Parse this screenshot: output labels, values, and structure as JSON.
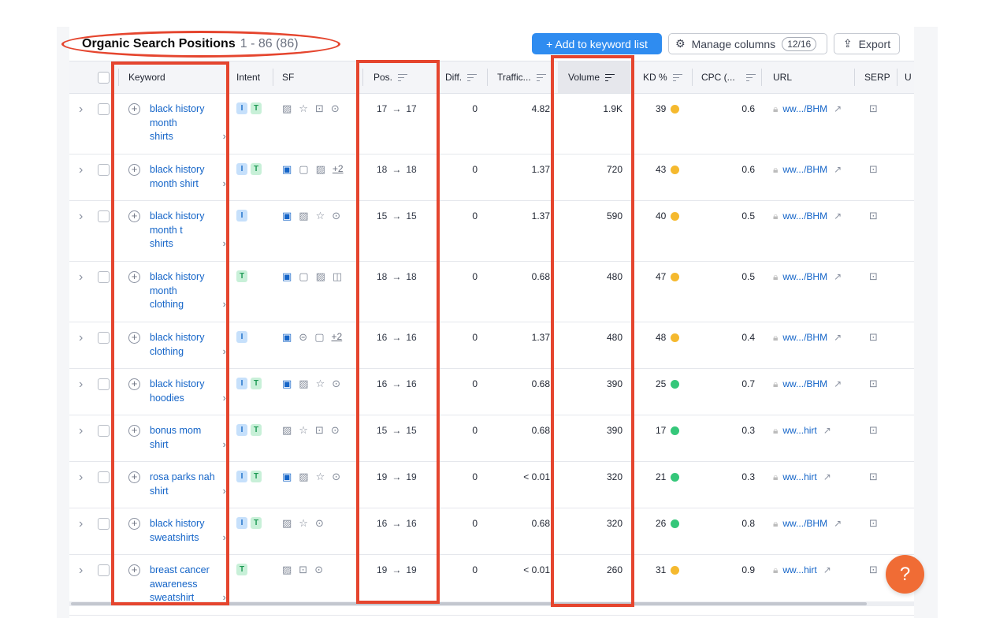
{
  "header": {
    "title": "Organic Search Positions",
    "range": "1 - 86 (86)"
  },
  "toolbar": {
    "add_label": "+  Add to keyword list",
    "manage_label": "Manage columns",
    "manage_badge": "12/16",
    "export_label": "Export"
  },
  "columns": {
    "keyword": "Keyword",
    "intent": "Intent",
    "sf": "SF",
    "pos": "Pos.",
    "diff": "Diff.",
    "traffic": "Traffic...",
    "volume": "Volume",
    "kd": "KD %",
    "cpc": "CPC (...",
    "url": "URL",
    "serp": "SERP",
    "more": "U"
  },
  "rows": [
    {
      "keyword": "black history month shirts",
      "kw_lines": [
        "black history",
        "month",
        "shirts"
      ],
      "intent": [
        "I",
        "T"
      ],
      "sf": [
        "img",
        "star",
        "pic",
        "vid"
      ],
      "pos_from": "17",
      "pos_to": "17",
      "diff": "0",
      "traffic": "4.82",
      "volume": "1.9K",
      "kd": "39",
      "kd_color": "yellow",
      "cpc": "0.6",
      "url": "ww.../BHM"
    },
    {
      "keyword": "black history month shirt",
      "kw_lines": [
        "black history",
        "month shirt"
      ],
      "intent": [
        "I",
        "T"
      ],
      "sf": [
        "pic-on",
        "chat",
        "img",
        "+2"
      ],
      "pos_from": "18",
      "pos_to": "18",
      "diff": "0",
      "traffic": "1.37",
      "volume": "720",
      "kd": "43",
      "kd_color": "yellow",
      "cpc": "0.6",
      "url": "ww.../BHM"
    },
    {
      "keyword": "black history month t shirts",
      "kw_lines": [
        "black history",
        "month t",
        "shirts"
      ],
      "intent": [
        "I"
      ],
      "sf": [
        "pic-on",
        "img",
        "star",
        "vid"
      ],
      "pos_from": "15",
      "pos_to": "15",
      "diff": "0",
      "traffic": "1.37",
      "volume": "590",
      "kd": "40",
      "kd_color": "yellow",
      "cpc": "0.5",
      "url": "ww.../BHM"
    },
    {
      "keyword": "black history month clothing",
      "kw_lines": [
        "black history",
        "month",
        "clothing"
      ],
      "intent": [
        "T"
      ],
      "sf": [
        "pic-on",
        "chat",
        "img",
        "carousel"
      ],
      "pos_from": "18",
      "pos_to": "18",
      "diff": "0",
      "traffic": "0.68",
      "volume": "480",
      "kd": "47",
      "kd_color": "yellow",
      "cpc": "0.5",
      "url": "ww.../BHM"
    },
    {
      "keyword": "black history clothing",
      "kw_lines": [
        "black history",
        "clothing"
      ],
      "intent": [
        "I"
      ],
      "sf": [
        "pic-on",
        "link",
        "chat",
        "+2"
      ],
      "pos_from": "16",
      "pos_to": "16",
      "diff": "0",
      "traffic": "1.37",
      "volume": "480",
      "kd": "48",
      "kd_color": "yellow",
      "cpc": "0.4",
      "url": "ww.../BHM"
    },
    {
      "keyword": "black history hoodies",
      "kw_lines": [
        "black history",
        "hoodies"
      ],
      "intent": [
        "I",
        "T"
      ],
      "sf": [
        "pic-on",
        "img",
        "star",
        "vid"
      ],
      "pos_from": "16",
      "pos_to": "16",
      "diff": "0",
      "traffic": "0.68",
      "volume": "390",
      "kd": "25",
      "kd_color": "green",
      "cpc": "0.7",
      "url": "ww.../BHM"
    },
    {
      "keyword": "bonus mom shirt",
      "kw_lines": [
        "bonus mom",
        "shirt"
      ],
      "intent": [
        "I",
        "T"
      ],
      "sf": [
        "img",
        "star",
        "pic",
        "vid"
      ],
      "pos_from": "15",
      "pos_to": "15",
      "diff": "0",
      "traffic": "0.68",
      "volume": "390",
      "kd": "17",
      "kd_color": "green",
      "cpc": "0.3",
      "url": "ww...hirt"
    },
    {
      "keyword": "rosa parks nah shirt",
      "kw_lines": [
        "rosa parks nah",
        "shirt"
      ],
      "intent": [
        "I",
        "T"
      ],
      "sf": [
        "pic-on",
        "img",
        "star",
        "vid"
      ],
      "pos_from": "19",
      "pos_to": "19",
      "diff": "0",
      "traffic": "< 0.01",
      "volume": "320",
      "kd": "21",
      "kd_color": "green",
      "cpc": "0.3",
      "url": "ww...hirt"
    },
    {
      "keyword": "black history sweatshirts",
      "kw_lines": [
        "black history",
        "sweatshirts"
      ],
      "intent": [
        "I",
        "T"
      ],
      "sf": [
        "img",
        "star",
        "vid"
      ],
      "pos_from": "16",
      "pos_to": "16",
      "diff": "0",
      "traffic": "0.68",
      "volume": "320",
      "kd": "26",
      "kd_color": "green",
      "cpc": "0.8",
      "url": "ww.../BHM"
    },
    {
      "keyword": "breast cancer awareness sweatshirt",
      "kw_lines": [
        "breast cancer",
        "awareness",
        "sweatshirt"
      ],
      "intent": [
        "T"
      ],
      "sf": [
        "img",
        "pic",
        "vid"
      ],
      "pos_from": "19",
      "pos_to": "19",
      "diff": "0",
      "traffic": "< 0.01",
      "volume": "260",
      "kd": "31",
      "kd_color": "yellow",
      "cpc": "0.9",
      "url": "ww...hirt"
    }
  ],
  "help_label": "?",
  "colors": {
    "accent": "#2f8cf0",
    "highlight": "#e5452e",
    "kd_yellow": "#f5b92e",
    "kd_green": "#35c77a",
    "help": "#f06c35"
  }
}
